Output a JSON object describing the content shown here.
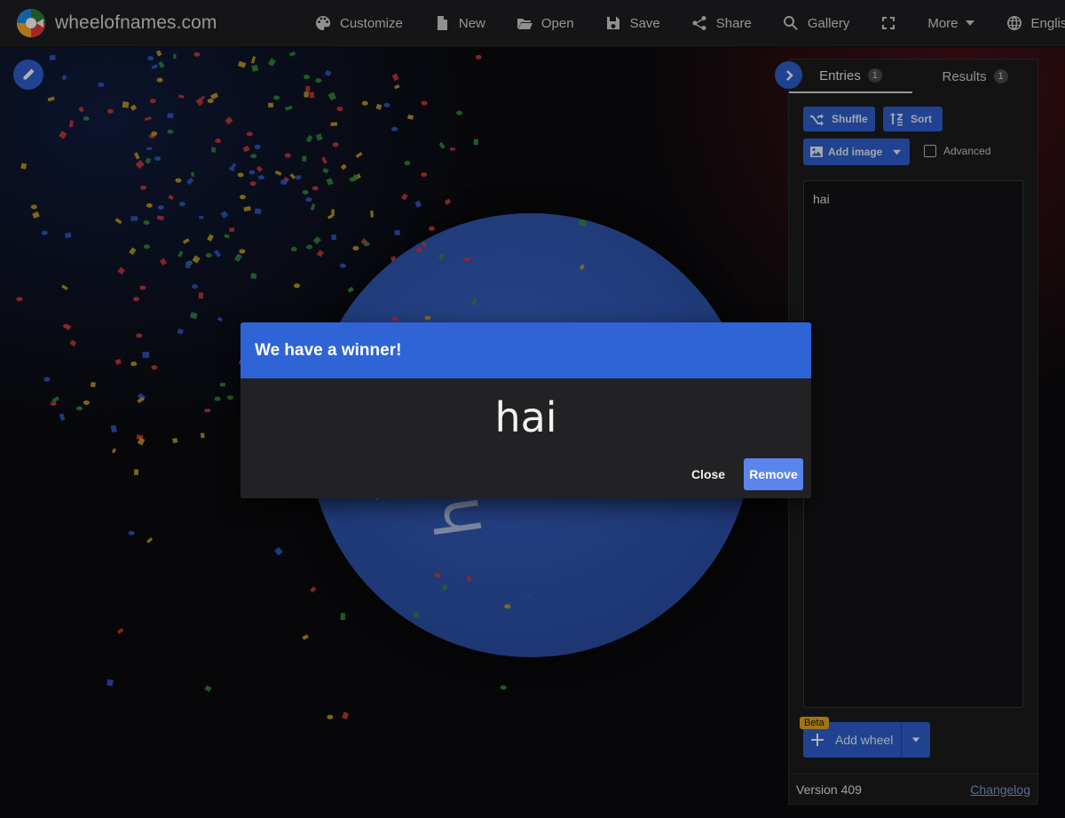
{
  "header": {
    "site_name": "wheelofnames.com",
    "nav": {
      "customize": "Customize",
      "new": "New",
      "open": "Open",
      "save": "Save",
      "share": "Share",
      "gallery": "Gallery",
      "more": "More",
      "language": "English"
    }
  },
  "wheel": {
    "segment_label": "hai",
    "color": "#2c50a8"
  },
  "panel": {
    "tabs": [
      {
        "label": "Entries",
        "count": "1"
      },
      {
        "label": "Results",
        "count": "1"
      }
    ],
    "buttons": {
      "shuffle": "Shuffle",
      "sort": "Sort",
      "add_image": "Add image"
    },
    "advanced_label": "Advanced",
    "entries_text": "hai",
    "beta_badge": "Beta",
    "add_wheel": "Add wheel",
    "version": "Version 409",
    "changelog": "Changelog"
  },
  "dialog": {
    "title": "We have a winner!",
    "winner": "hai",
    "close": "Close",
    "remove": "Remove"
  },
  "colors": {
    "accent": "#2f64d6",
    "remove_button": "#5a84ee",
    "beta": "#e2a91c"
  }
}
